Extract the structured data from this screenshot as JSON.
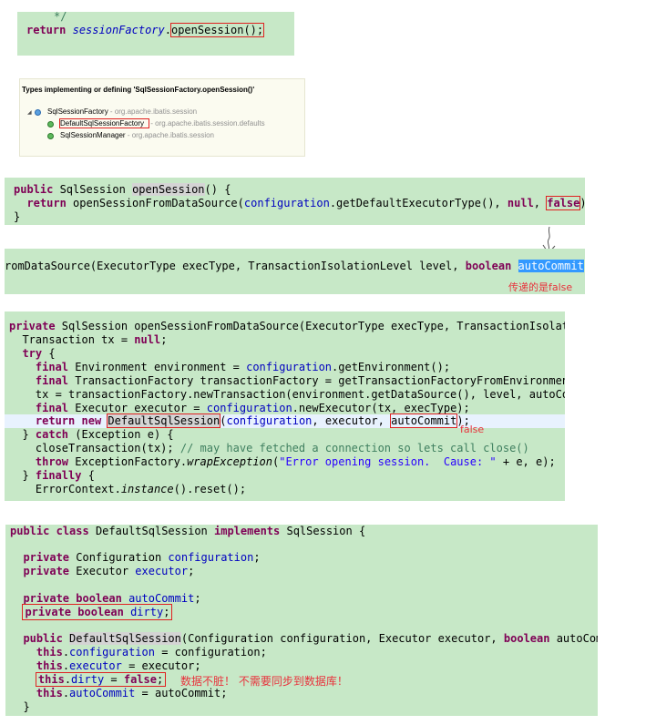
{
  "panel1": {
    "comment": "*/",
    "kw_return": "return",
    "var": "sessionFactory",
    "dot": ".",
    "call": "openSession();"
  },
  "hierarchy": {
    "title": "Types implementing or defining 'SqlSessionFactory.openSession()'",
    "root_name": "SqlSessionFactory",
    "root_pkg": " - org.apache.ibatis.session",
    "child1_name": "DefaultSqlSessionFactory",
    "child1_pkg": " - org.apache.ibatis.session.defaults",
    "child2_name": "SqlSessionManager",
    "child2_pkg": " - org.apache.ibatis.session"
  },
  "panel3": {
    "l1_kw": "public",
    "l1_rest": " SqlSession ",
    "l1_method": "openSession",
    "l1_end": "() {",
    "l2_kw": "return",
    "l2_a": " openSessionFromDataSource(",
    "l2_field": "configuration",
    "l2_b": ".getDefaultExecutorType(), ",
    "l2_null": "null",
    "l2_c": ", ",
    "l2_false": "false",
    "l2_end": ");",
    "l3": "}"
  },
  "panel4": {
    "a": "romDataSource(ExecutorType execType, TransactionIsolationLevel level, ",
    "kw": "boolean",
    "sp": " ",
    "param": "autoCommit",
    "end": ")",
    "note": "传递的是false"
  },
  "panel5": {
    "l1_kw": "private",
    "l1_rest": " SqlSession openSessionFromDataSource(ExecutorType execType, TransactionIsolati",
    "l2_a": "  Transaction tx = ",
    "l2_null": "null",
    "l2_end": ";",
    "l3_kw": "try",
    "l3_end": " {",
    "l4_kw": "final",
    "l4_a": " Environment environment = ",
    "l4_field": "configuration",
    "l4_b": ".getEnvironment();",
    "l5_kw": "final",
    "l5_a": " TransactionFactory transactionFactory = getTransactionFactoryFromEnvironment",
    "l6": "    tx = transactionFactory.newTransaction(environment.getDataSource(), level, autoCom",
    "l7_kw": "final",
    "l7_a": " Executor executor = ",
    "l7_field": "configuration",
    "l7_b": ".newExecutor(tx, execType);",
    "l8_kw1": "return",
    "l8_kw2": "new",
    "l8_cls": "DefaultSqlSession",
    "l8_a": "(",
    "l8_field": "configuration",
    "l8_b": ", executor, ",
    "l8_param": "autoCommit",
    "l8_end": ");",
    "l8_note": "false",
    "l9_a": "  } ",
    "l9_kw": "catch",
    "l9_b": " (Exception e) {",
    "l10": "    closeTransaction(tx); ",
    "l10_cmt": "// may have fetched a connection so lets call close()",
    "l11_kw": "throw",
    "l11_a": " ExceptionFactory.",
    "l11_ital": "wrapException",
    "l11_b": "(",
    "l11_str": "\"Error opening session.  Cause: \"",
    "l11_c": " + e, e);",
    "l12_a": "  } ",
    "l12_kw": "finally",
    "l12_b": " {",
    "l13_a": "    ErrorContext.",
    "l13_ital": "instance",
    "l13_b": "().reset();"
  },
  "panel6": {
    "l1_kw1": "public",
    "l1_kw2": "class",
    "l1_a": " DefaultSqlSession ",
    "l1_kw3": "implements",
    "l1_b": " SqlSession {",
    "l2_kw": "private",
    "l2_a": " Configuration ",
    "l2_field": "configuration",
    "l2_end": ";",
    "l3_kw": "private",
    "l3_a": " Executor ",
    "l3_field": "executor",
    "l3_end": ";",
    "l4_kw1": "private",
    "l4_kw2": "boolean",
    "l4_field": "autoCommit",
    "l4_end": ";",
    "l5_kw1": "private",
    "l5_kw2": "boolean",
    "l5_field": "dirty",
    "l5_end": ";",
    "l6_kw": "public",
    "l6_cls": "DefaultSqlSession",
    "l6_a": "(Configuration configuration, Executor executor, ",
    "l6_kw2": "boolean",
    "l6_b": " autoComm",
    "l7_kw": "this",
    "l7_field": "configuration",
    "l7_end": " = configuration;",
    "l8_kw": "this",
    "l8_field": "executor",
    "l8_end": " = executor;",
    "l9_kw": "this",
    "l9_field": "dirty",
    "l9_a": " = ",
    "l9_false": "false",
    "l9_end": ";",
    "l9_note": "数据不脏！ 不需要同步到数据库！",
    "l10_kw": "this",
    "l10_field": "autoCommit",
    "l10_end": " = autoCommit;",
    "l11": "}"
  }
}
